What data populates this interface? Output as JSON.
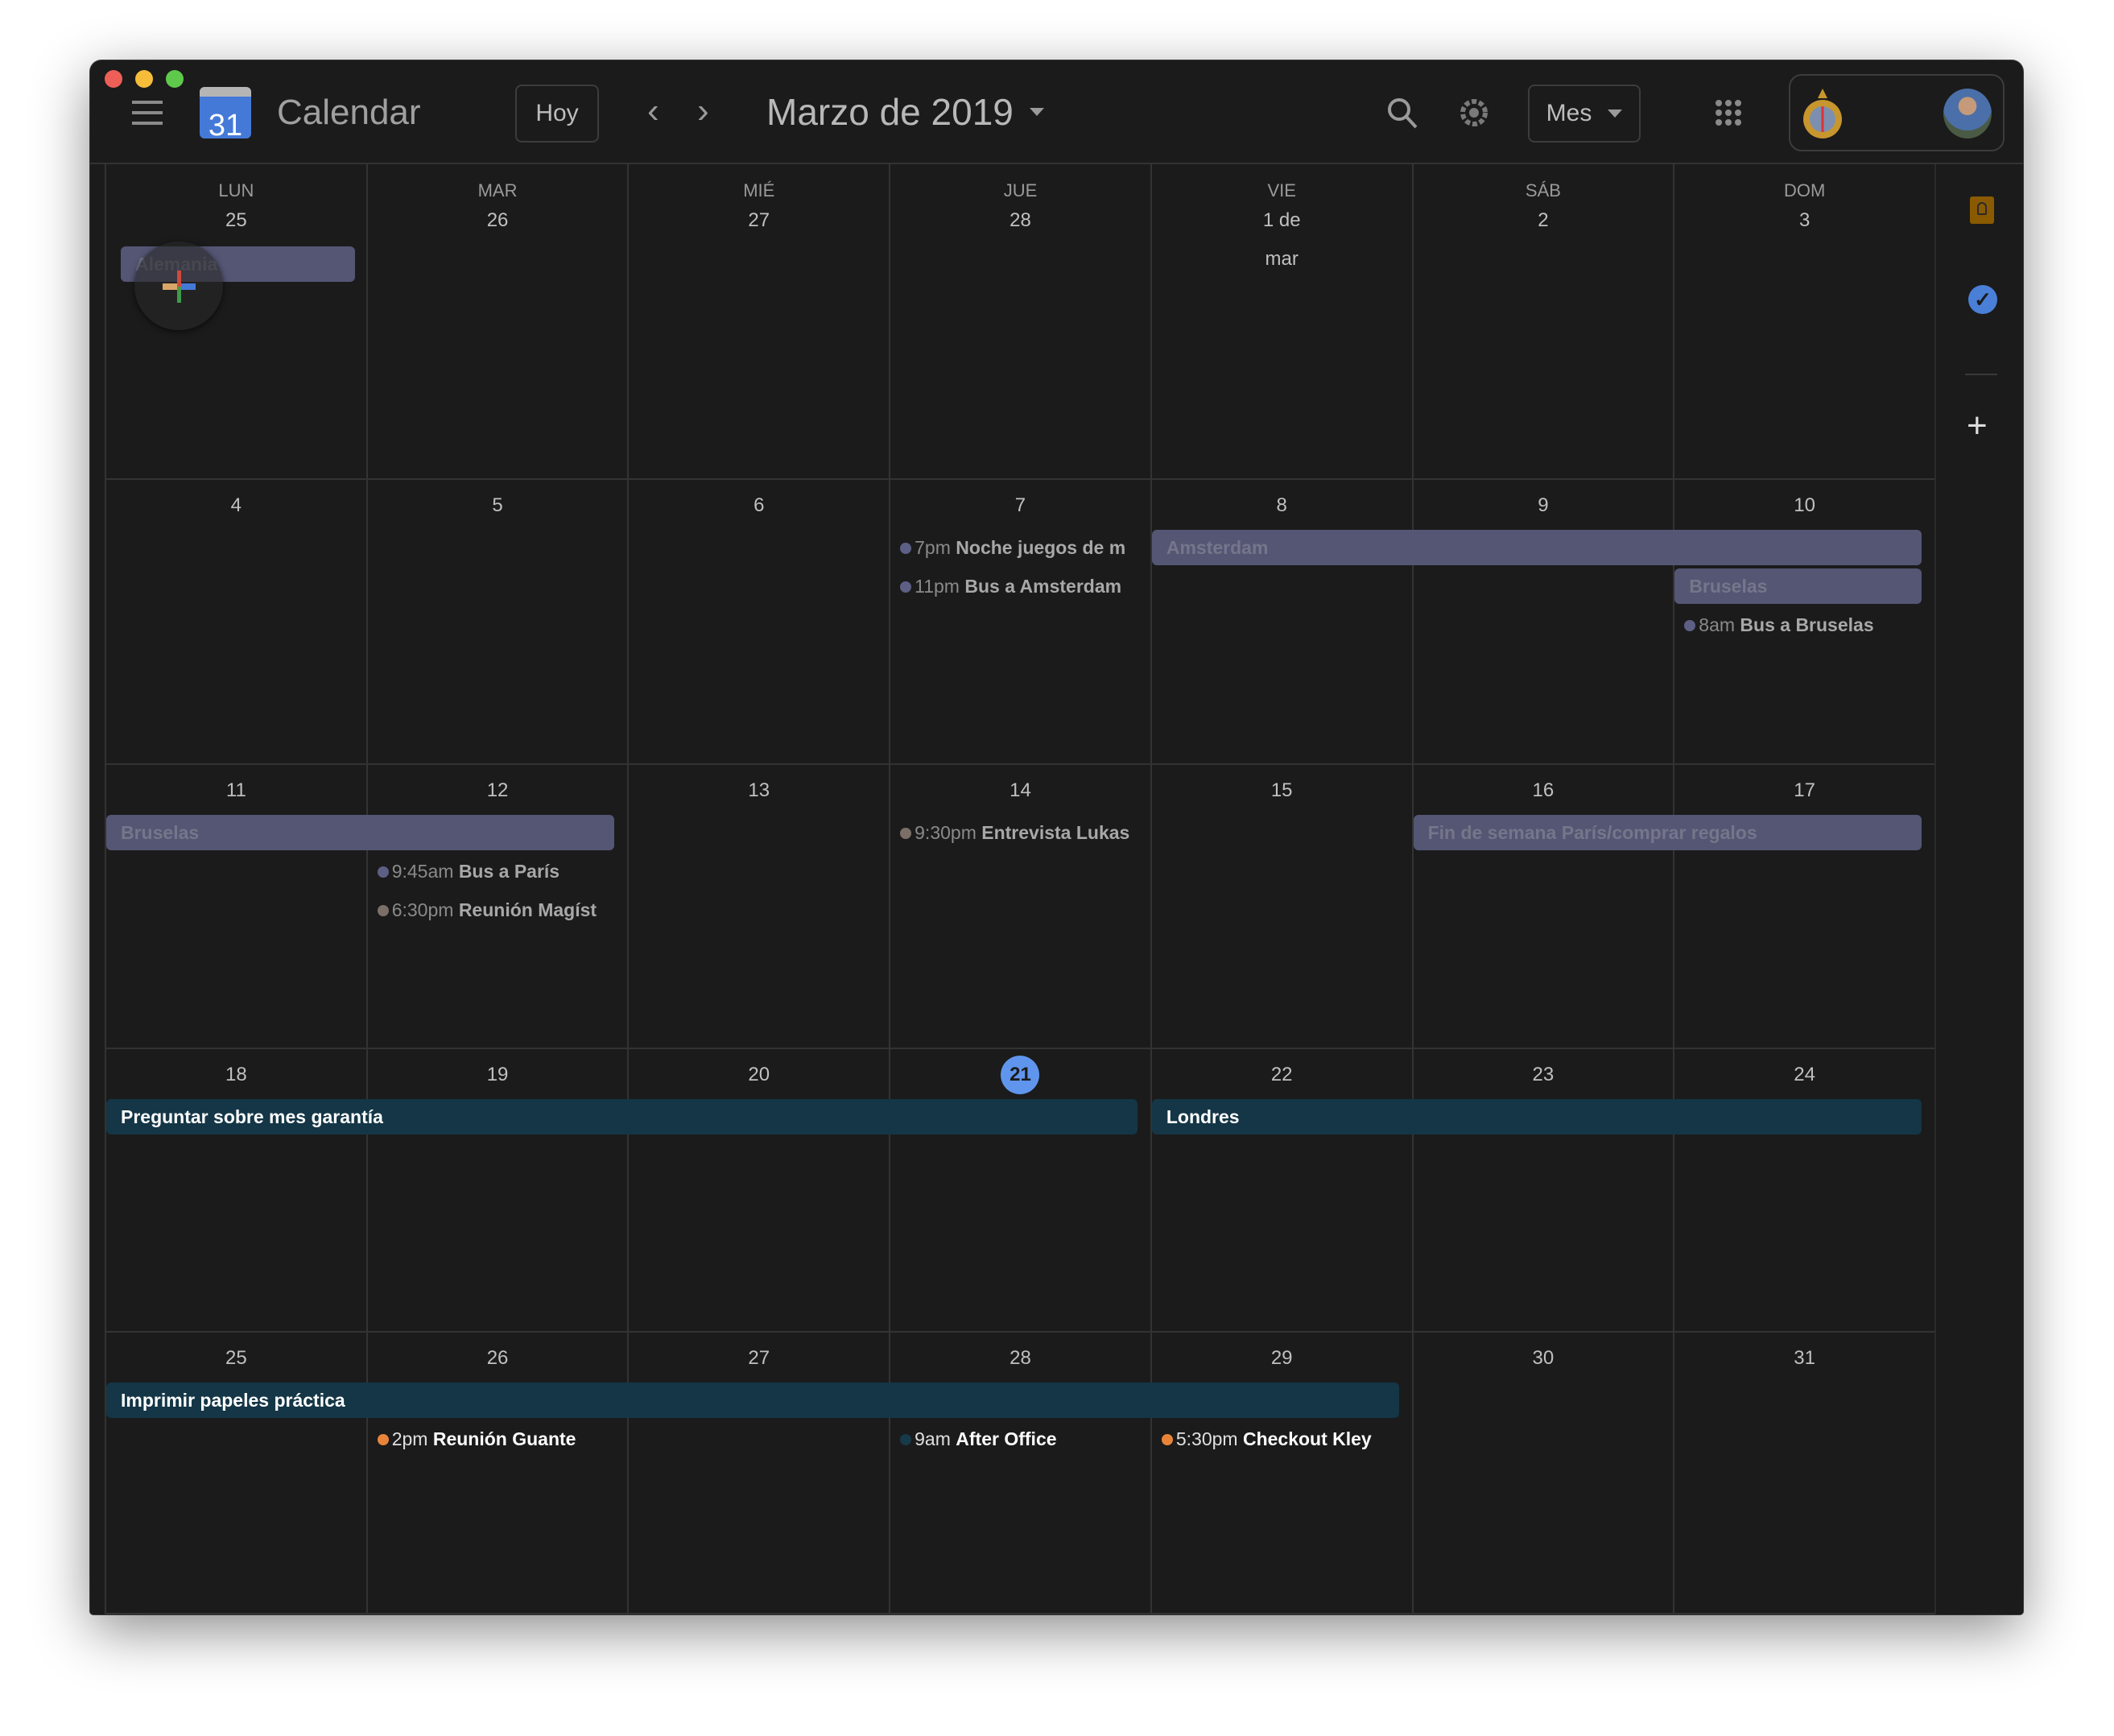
{
  "app": {
    "title": "Calendar",
    "logo_day": "31"
  },
  "toolbar": {
    "today": "Hoy",
    "month_title": "Marzo de 2019",
    "view": "Mes"
  },
  "weekdays": [
    "LUN",
    "MAR",
    "MIÉ",
    "JUE",
    "VIE",
    "SÁB",
    "DOM"
  ],
  "weeks": [
    {
      "days": [
        "25",
        "26",
        "27",
        "28",
        "1 de mar",
        "2",
        "3"
      ]
    },
    {
      "days": [
        "4",
        "5",
        "6",
        "7",
        "8",
        "9",
        "10"
      ]
    },
    {
      "days": [
        "11",
        "12",
        "13",
        "14",
        "15",
        "16",
        "17"
      ]
    },
    {
      "days": [
        "18",
        "19",
        "20",
        "21",
        "22",
        "23",
        "24"
      ]
    },
    {
      "days": [
        "25",
        "26",
        "27",
        "28",
        "29",
        "30",
        "31"
      ]
    }
  ],
  "today": {
    "week": 3,
    "day": 3
  },
  "colors": {
    "lavender": "#545674",
    "teal": "#143646",
    "today": "#5f95ec"
  },
  "bar_events": [
    {
      "week": 0,
      "start": 0,
      "span": 1,
      "slot": 0,
      "title": "Alemania",
      "style": "lavender"
    },
    {
      "week": 1,
      "start": 4,
      "span": 3,
      "slot": 0,
      "title": "Amsterdam",
      "style": "lavender"
    },
    {
      "week": 1,
      "start": 6,
      "span": 1,
      "slot": 1,
      "title": "Bruselas",
      "style": "lavender"
    },
    {
      "week": 2,
      "start": 0,
      "span": 2,
      "slot": 0,
      "title": "Bruselas",
      "style": "lavender"
    },
    {
      "week": 2,
      "start": 5,
      "span": 2,
      "slot": 0,
      "title": "Fin de semana París/comprar regalos",
      "style": "lavender"
    },
    {
      "week": 3,
      "start": 0,
      "span": 4,
      "slot": 0,
      "title": "Preguntar sobre mes garantía",
      "style": "teal"
    },
    {
      "week": 3,
      "start": 4,
      "span": 3,
      "slot": 0,
      "title": "Londres",
      "style": "teal"
    },
    {
      "week": 4,
      "start": 0,
      "span": 5,
      "slot": 0,
      "title": "Imprimir papeles práctica",
      "style": "teal"
    }
  ],
  "timed_events": [
    {
      "week": 1,
      "day": 3,
      "slot": 0,
      "time": "7pm",
      "title": "Noche juegos de m",
      "dot": "#5d5f85"
    },
    {
      "week": 1,
      "day": 3,
      "slot": 1,
      "time": "11pm",
      "title": "Bus a Amsterdam",
      "dot": "#5d5f85"
    },
    {
      "week": 1,
      "day": 6,
      "slot": 2,
      "time": "8am",
      "title": "Bus a Bruselas",
      "dot": "#5d5f85"
    },
    {
      "week": 2,
      "day": 1,
      "slot": 1,
      "time": "9:45am",
      "title": "Bus a París",
      "dot": "#5d5f85"
    },
    {
      "week": 2,
      "day": 1,
      "slot": 2,
      "time": "6:30pm",
      "title": "Reunión Magíst",
      "dot": "#7b6f68"
    },
    {
      "week": 2,
      "day": 3,
      "slot": 0,
      "time": "9:30pm",
      "title": "Entrevista Lukas",
      "dot": "#7b6f68"
    },
    {
      "week": 4,
      "day": 1,
      "slot": 1,
      "time": "2pm",
      "title": "Reunión Guante",
      "dot": "#e8843a",
      "bright": true
    },
    {
      "week": 4,
      "day": 3,
      "slot": 1,
      "time": "9am",
      "title": "After Office",
      "dot": "#163a4a",
      "bright": true
    },
    {
      "week": 4,
      "day": 4,
      "slot": 1,
      "time": "5:30pm",
      "title": "Checkout Kley",
      "dot": "#e8843a",
      "bright": true
    }
  ]
}
